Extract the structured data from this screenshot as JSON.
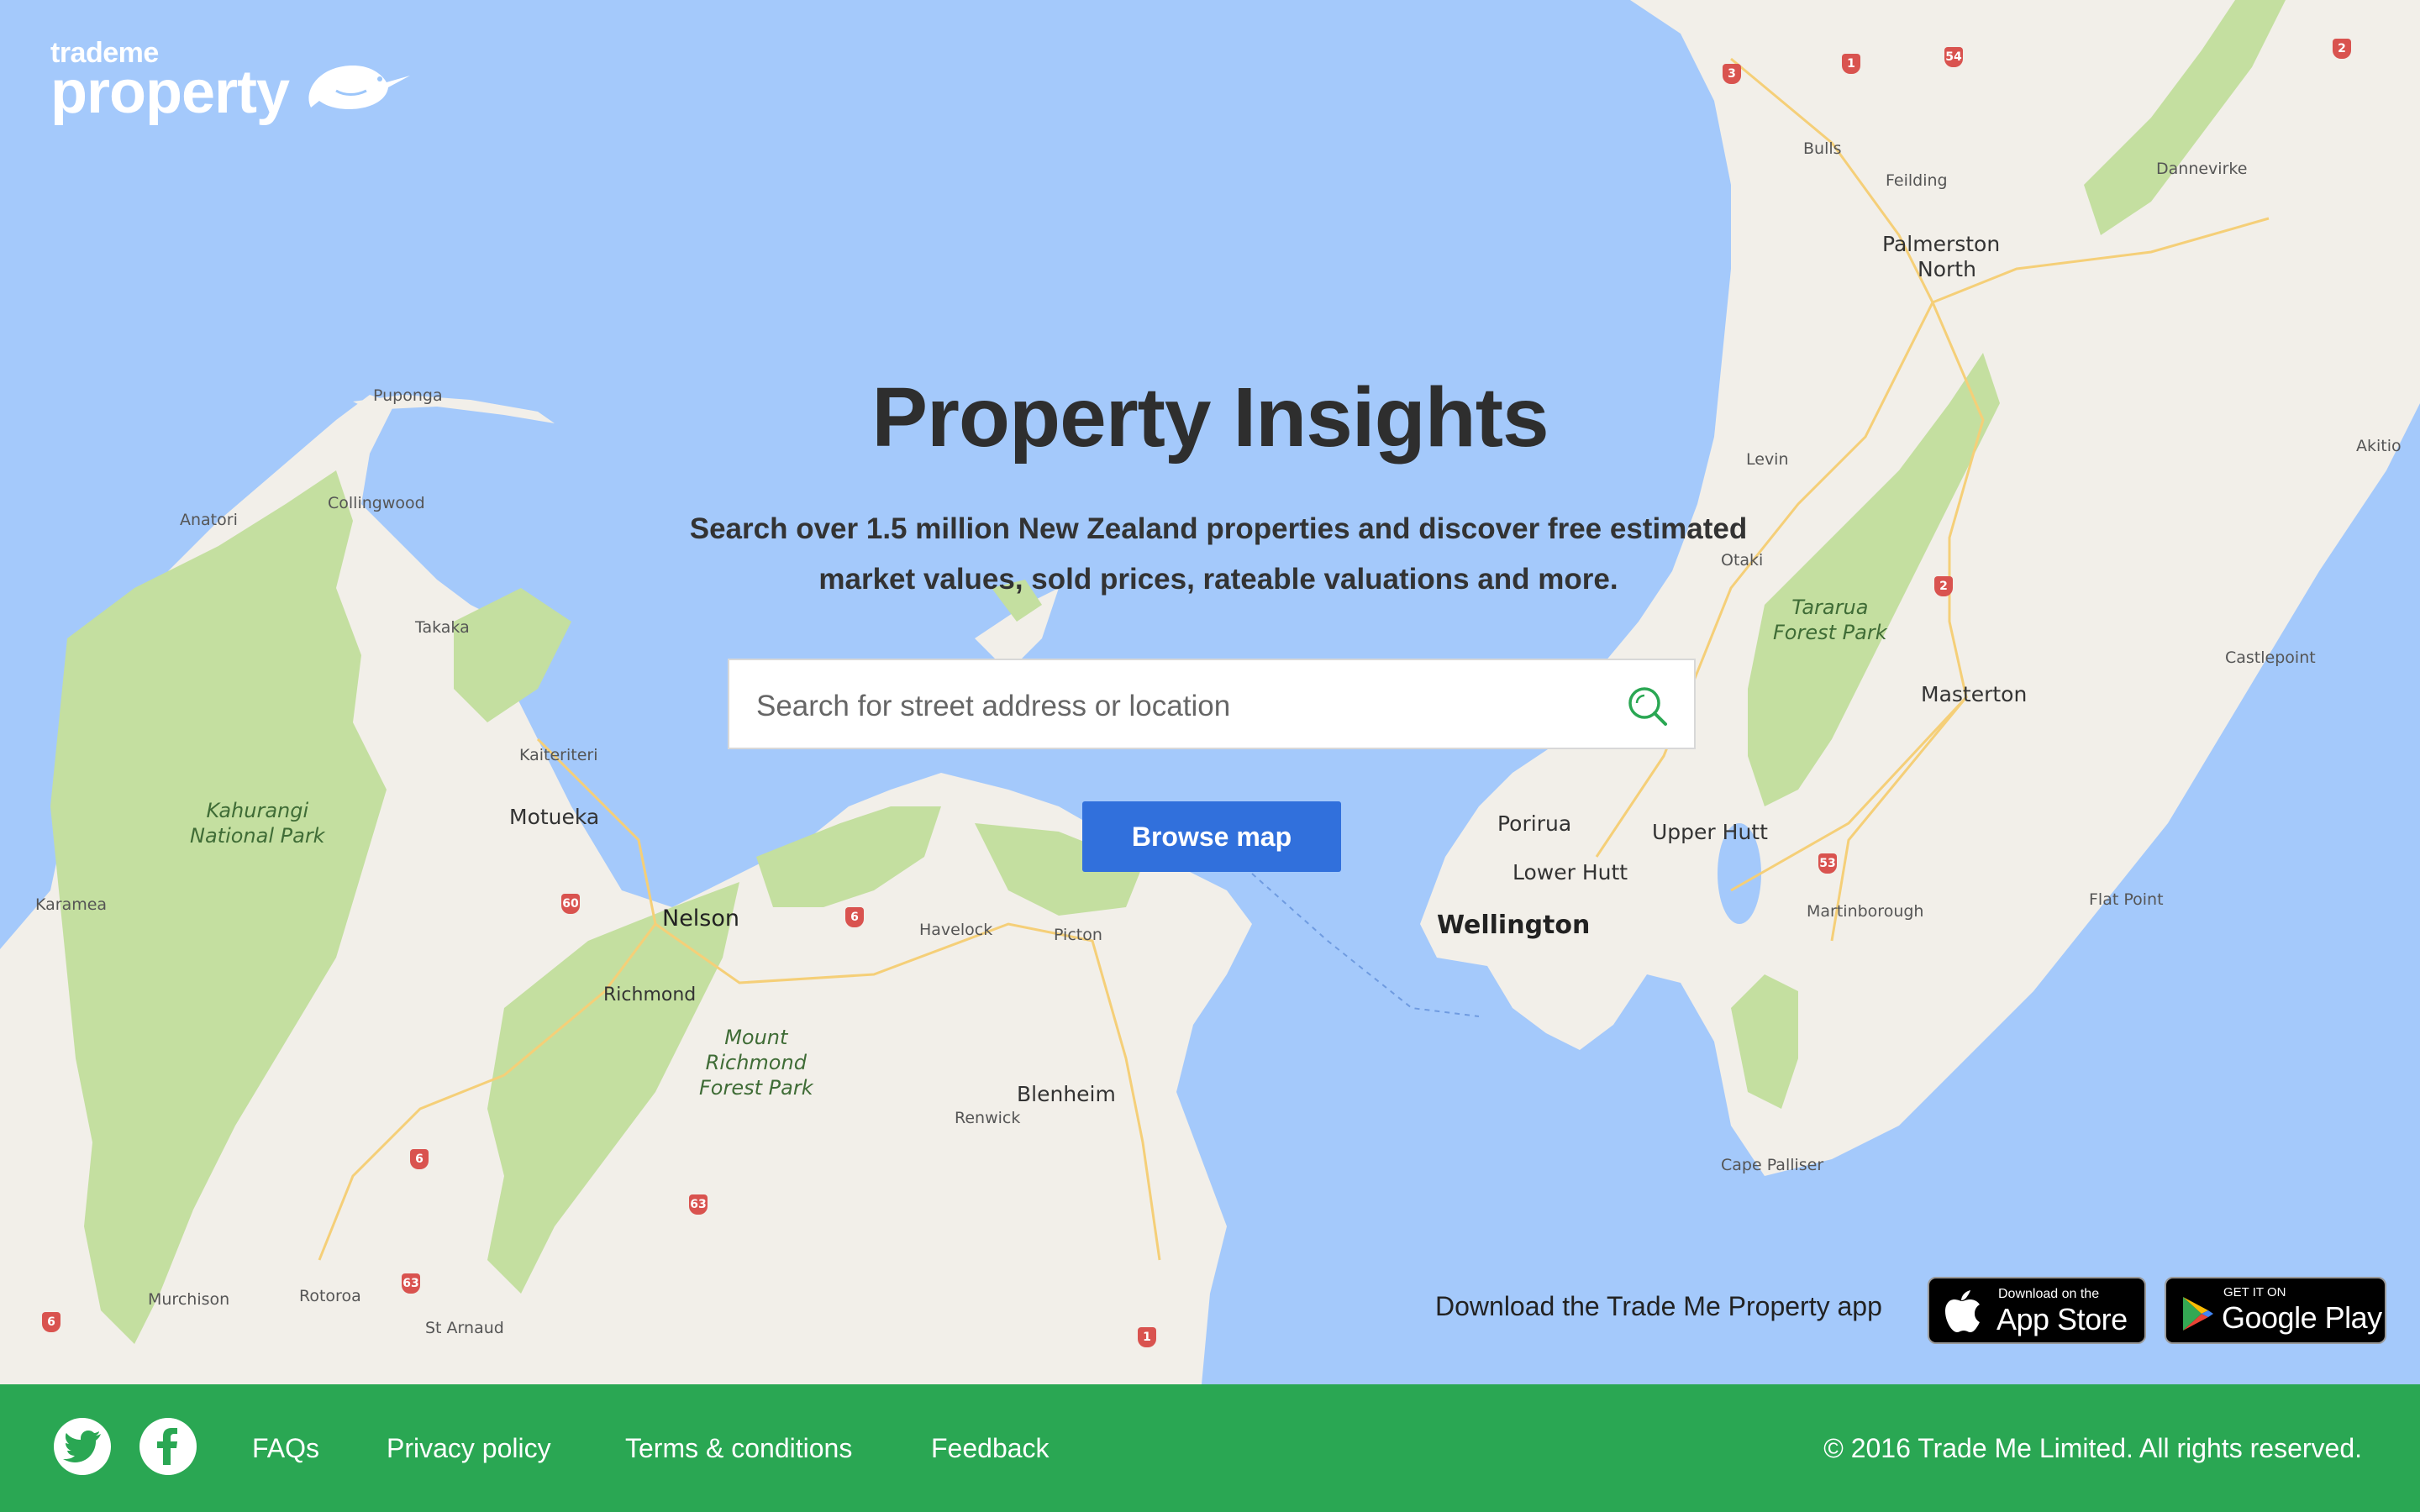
{
  "brand": {
    "top": "trademe",
    "main": "property"
  },
  "hero": {
    "title": "Property Insights",
    "subtitle_line1": "Search over 1.5 million New Zealand properties and discover free estimated",
    "subtitle_line2": "market values, sold prices, rateable valuations and more."
  },
  "search": {
    "placeholder": "Search for street address or location"
  },
  "browse_button": "Browse map",
  "app": {
    "label": "Download the Trade Me Property app",
    "appstore_small": "Download on the",
    "appstore_large": "App Store",
    "googleplay_small": "GET IT ON",
    "googleplay_large": "Google Play"
  },
  "map_labels": {
    "puponga": "Puponga",
    "anatori": "Anatori",
    "collingwood": "Collingwood",
    "takaka": "Takaka",
    "kaiteriteri": "Kaiteriteri",
    "motueka": "Motueka",
    "karamea": "Karamea",
    "nelson": "Nelson",
    "richmond": "Richmond",
    "havelock": "Havelock",
    "picton": "Picton",
    "blenheim": "Blenheim",
    "renwick": "Renwick",
    "murchison": "Murchison",
    "rotoroa": "Rotoroa",
    "st_arnaud": "St Arnaud",
    "bulls": "Bulls",
    "feilding": "Feilding",
    "dannevirke": "Dannevirke",
    "palmerston_1": "Palmerston",
    "palmerston_2": "North",
    "levin": "Levin",
    "akitio": "Akitio",
    "otaki": "Otaki",
    "masterton": "Masterton",
    "castlepoint": "Castlepoint",
    "porirua": "Porirua",
    "upper_hutt": "Upper Hutt",
    "lower_hutt": "Lower Hutt",
    "wellington": "Wellington",
    "martinborough": "Martinborough",
    "flat_point": "Flat Point",
    "cape_palliser": "Cape Palliser",
    "kahurangi_1": "Kahurangi",
    "kahurangi_2": "National Park",
    "tararua_1": "Tararua",
    "tararua_2": "Forest Park",
    "mtrichmond_1": "Mount",
    "mtrichmond_2": "Richmond",
    "mtrichmond_3": "Forest Park"
  },
  "road_shields": {
    "s3": "3",
    "s1a": "1",
    "s54": "54",
    "s2a": "2",
    "s2b": "2",
    "s53": "53",
    "s60": "60",
    "s6a": "6",
    "s6b": "6",
    "s63a": "63",
    "s63b": "63",
    "s6c": "6",
    "s1b": "1"
  },
  "footer": {
    "faqs": "FAQs",
    "privacy": "Privacy policy",
    "terms": "Terms & conditions",
    "feedback": "Feedback",
    "copyright": "© 2016 Trade Me Limited. All rights reserved."
  },
  "colors": {
    "sea": "#a4c9fb",
    "land": "#f2efe9",
    "forest": "#c4dfa0",
    "brand_green": "#2aa753",
    "button_blue": "#3170dc"
  }
}
